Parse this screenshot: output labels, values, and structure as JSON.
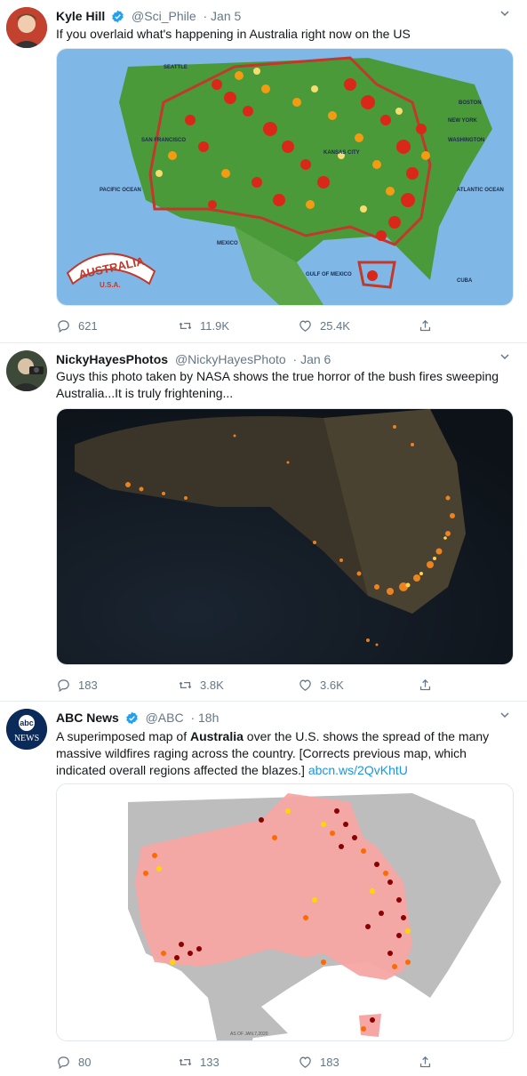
{
  "tweets": [
    {
      "name": "Kyle Hill",
      "handle": "@Sci_Phile",
      "date": "· Jan 5",
      "text": "If you overlaid what's happening in Australia right now on the US",
      "replies": "621",
      "retweets": "11.9K",
      "likes": "25.4K",
      "map_labels": {
        "seattle": "SEATTLE",
        "san_francisco": "SAN FRANCISCO",
        "boston": "BOSTON",
        "new_york": "NEW YORK",
        "washington": "WASHINGTON",
        "kansas_city": "KANSAS CITY",
        "pacific": "PACIFIC OCEAN",
        "atlantic": "ATLANTIC OCEAN",
        "mexico": "MEXICO",
        "gulf": "GULF OF MEXICO",
        "cuba": "CUBA",
        "banner_top": "AUSTRALIA",
        "banner_bottom": "U.S.A."
      }
    },
    {
      "name": "NickyHayesPhotos",
      "handle": "@NickyHayesPhoto",
      "date": "· Jan 6",
      "text": "Guys this photo taken by NASA shows the true horror of the bush fires sweeping Australia...It is truly frightening...",
      "replies": "183",
      "retweets": "3.8K",
      "likes": "3.6K"
    },
    {
      "name": "ABC News",
      "handle": "@ABC",
      "date": "· 18h",
      "text_before": "A superimposed map of ",
      "text_bold": "Australia",
      "text_after": " over the U.S. shows the spread of the many massive wildfires raging across the country. [Corrects previous map, which indicated overall regions affected the blazes.] ",
      "link": "abcn.ws/2QvKhtU",
      "avatar_top": "abc",
      "avatar_bottom": "NEWS",
      "map_caption": "AS OF JAN.7,2020",
      "replies": "80",
      "retweets": "133",
      "likes": "183"
    }
  ],
  "colors": {
    "link": "#1b95e0",
    "verified": "#1da1f2",
    "meta": "#657786"
  }
}
